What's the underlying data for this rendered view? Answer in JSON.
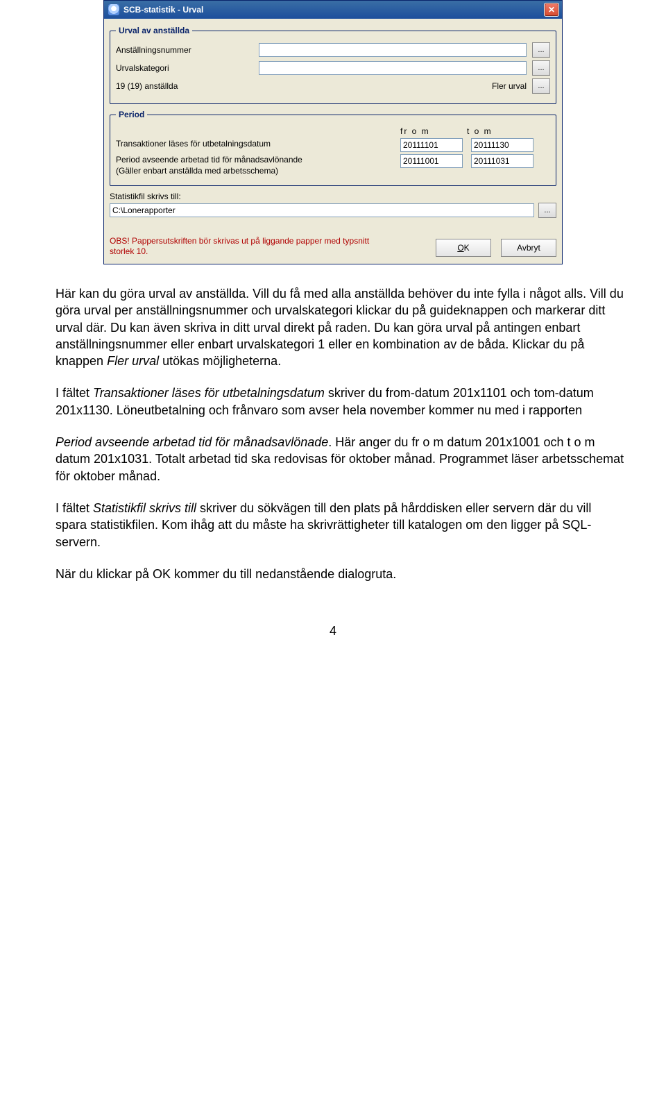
{
  "dialog": {
    "title": "SCB-statistik - Urval",
    "group_urval": {
      "legend": "Urval av anställda",
      "anstallningsnummer_label": "Anställningsnummer",
      "anstallningsnummer_value": "",
      "urvalskategori_label": "Urvalskategori",
      "urvalskategori_value": "",
      "count_text": "19 (19) anställda",
      "fler_urval_label": "Fler urval"
    },
    "group_period": {
      "legend": "Period",
      "col_from": "fr o m",
      "col_to": "t o m",
      "trans_label": "Transaktioner läses för utbetalningsdatum",
      "trans_from": "20111101",
      "trans_to": "20111130",
      "arbetad_label": "Period avseende arbetad tid för månadsavlönande\n(Gäller enbart anställda med arbetsschema)",
      "arbetad_from": "20111001",
      "arbetad_to": "20111031"
    },
    "stat_label": "Statistikfil skrivs till:",
    "stat_value": "C:\\Lonerapporter",
    "warning": "OBS! Pappersutskriften bör skrivas ut på liggande papper med typsnitt storlek 10.",
    "ok_label": "OK",
    "cancel_label": "Avbryt",
    "dots": "..."
  },
  "doc": {
    "p1_a": "Här kan du göra urval av anställda. Vill du få med alla anställda behöver du inte fylla i något alls. Vill du göra urval per anställningsnummer och urvalskategori klickar du på guideknappen och markerar ditt urval där. Du kan även skriva in ditt urval direkt på raden. Du kan göra urval på antingen enbart anställningsnummer eller enbart urvalskategori 1 eller en kombination av de båda. Klickar du på knappen ",
    "p1_em": "Fler urval",
    "p1_b": " utökas möjligheterna.",
    "p2_a": "I fältet ",
    "p2_em": "Transaktioner läses för utbetalningsdatum",
    "p2_b": " skriver du from-datum 201x1101 och tom-datum 201x1130. Löneutbetalning och frånvaro som avser hela november kommer nu med i rapporten",
    "p3_em": "Period avseende arbetad tid för månadsavlönade",
    "p3_b": ". Här anger du fr o m datum 201x1001 och t o m datum 201x1031. Totalt arbetad tid ska redovisas för oktober månad. Programmet läser arbetsschemat för oktober månad.",
    "p4_a": "I fältet ",
    "p4_em": "Statistikfil skrivs till",
    "p4_b": " skriver du sökvägen till den plats på hårddisken eller servern där du vill spara statistikfilen. Kom ihåg att du måste ha skrivrättigheter till katalogen om den ligger på SQL-servern.",
    "p5": "När du klickar på OK kommer du till nedanstående dialogruta.",
    "page_number": "4"
  }
}
